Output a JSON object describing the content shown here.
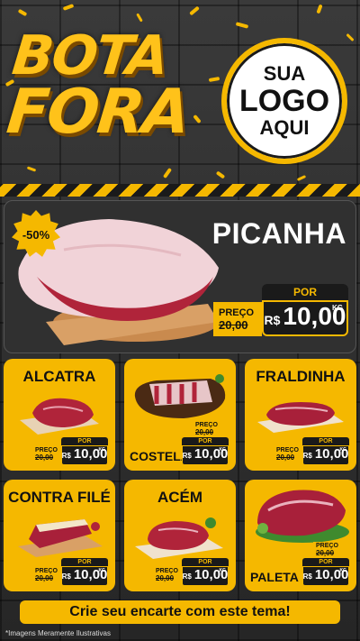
{
  "header": {
    "title_line1": "BOTA",
    "title_line2": "FORA",
    "logo": {
      "line1": "SUA",
      "line2": "LOGO",
      "line3": "AQUI"
    }
  },
  "hero": {
    "name": "PICANHA",
    "discount": "-50%",
    "price_label": "PREÇO",
    "old_price": "20,00",
    "por_label": "POR",
    "currency": "R$",
    "new_price": "10,00",
    "unit": "KG"
  },
  "cards": [
    {
      "name": "ALCATRA",
      "price_label": "PREÇO",
      "old_price": "20,00",
      "por_label": "POR",
      "currency": "R$",
      "new_price": "10,00",
      "unit": "KG"
    },
    {
      "name": "COSTELA",
      "price_label": "PREÇO",
      "old_price": "20,00",
      "por_label": "POR",
      "currency": "R$",
      "new_price": "10,00",
      "unit": "KG"
    },
    {
      "name": "FRALDINHA",
      "price_label": "PREÇO",
      "old_price": "20,00",
      "por_label": "POR",
      "currency": "R$",
      "new_price": "10,00",
      "unit": "KG"
    },
    {
      "name": "CONTRA FILÉ",
      "price_label": "PREÇO",
      "old_price": "20,00",
      "por_label": "POR",
      "currency": "R$",
      "new_price": "10,00",
      "unit": "KG"
    },
    {
      "name": "ACÉM",
      "price_label": "PREÇO",
      "old_price": "20,00",
      "por_label": "POR",
      "currency": "R$",
      "new_price": "10,00",
      "unit": "KG"
    },
    {
      "name": "PALETA",
      "price_label": "PREÇO",
      "old_price": "20,00",
      "por_label": "POR",
      "currency": "R$",
      "new_price": "10,00",
      "unit": "KG"
    }
  ],
  "footer": {
    "cta": "Crie seu encarte com este tema!",
    "disclaimer": "*Imagens Meramente Ilustrativas"
  },
  "colors": {
    "accent": "#f5b800",
    "background": "#2b2b2b",
    "meat": "#b0243a",
    "board": "#d9a066"
  }
}
